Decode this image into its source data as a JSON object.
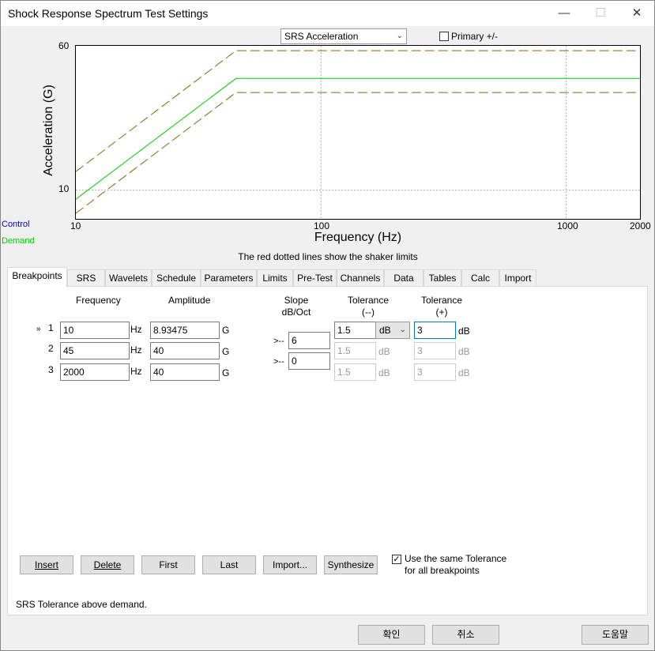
{
  "window": {
    "title": "Shock Response Spectrum Test Settings",
    "minimize": "—",
    "maximize": "☐",
    "close": "✕"
  },
  "top": {
    "view_select": "SRS Acceleration",
    "primary_label": "Primary +/-",
    "primary_checked": false
  },
  "legend": {
    "control": "Control",
    "demand": "Demand",
    "control_color": "#0000cc",
    "demand_color": "#00cc00"
  },
  "chart_data": {
    "type": "line",
    "xscale": "log",
    "yscale": "log",
    "xlim": [
      10,
      2000
    ],
    "ylim": [
      7,
      60
    ],
    "xlabel": "Frequency (Hz)",
    "ylabel": "Acceleration (G)",
    "xticks": [
      "10",
      "100",
      "1000",
      "2000"
    ],
    "yticks": [
      "60",
      "10"
    ],
    "grid": true,
    "series": [
      {
        "role": "demand",
        "color": "#00cc00",
        "style": "solid",
        "x": [
          10,
          45,
          2000
        ],
        "y": [
          8.93475,
          40,
          40
        ]
      },
      {
        "role": "upper-tolerance",
        "color": "#8b6508",
        "style": "dashed",
        "x": [
          10,
          45,
          2000
        ],
        "y": [
          12.6,
          56.5,
          56.5
        ]
      },
      {
        "role": "lower-tolerance",
        "color": "#8b6508",
        "style": "dashed",
        "x": [
          10,
          45,
          2000
        ],
        "y": [
          7.5,
          33.6,
          33.6
        ]
      }
    ]
  },
  "note": "The red dotted lines show the shaker limits",
  "tabs": [
    "Breakpoints",
    "SRS",
    "Wavelets",
    "Schedule",
    "Parameters",
    "Limits",
    "Pre-Test",
    "Channels",
    "Data",
    "Tables",
    "Calc",
    "Import"
  ],
  "headers": {
    "frequency": "Frequency",
    "amplitude": "Amplitude",
    "slope1": "Slope",
    "slope2": "dB/Oct",
    "tol_minus1": "Tolerance",
    "tol_minus2": "(--)",
    "tol_plus1": "Tolerance",
    "tol_plus2": "(+)"
  },
  "units": {
    "hz": "Hz",
    "g": "G",
    "db": "dB"
  },
  "rows": [
    {
      "marker": "»",
      "index": "1",
      "frequency": "10",
      "amplitude": "8.93475",
      "tol_minus": "1.5",
      "tol_plus": "3"
    },
    {
      "marker": "",
      "index": "2",
      "frequency": "45",
      "amplitude": "40",
      "tol_minus": "1.5",
      "tol_plus": "3"
    },
    {
      "marker": "",
      "index": "3",
      "frequency": "2000",
      "amplitude": "40",
      "tol_minus": "1.5",
      "tol_plus": "3"
    }
  ],
  "slopes": [
    {
      "arrow": ">--",
      "value": "6"
    },
    {
      "arrow": ">--",
      "value": "0"
    }
  ],
  "tol_unit_select": "dB",
  "buttons": {
    "insert": "Insert",
    "delete": "Delete",
    "first": "First",
    "last": "Last",
    "import": "Import...",
    "synthesize": "Synthesize"
  },
  "same_tol": {
    "line1": "Use the same Tolerance",
    "line2": "for all breakpoints",
    "checked": true
  },
  "status": "SRS Tolerance above demand.",
  "footer": {
    "ok": "확인",
    "cancel": "취소",
    "help": "도움말"
  }
}
